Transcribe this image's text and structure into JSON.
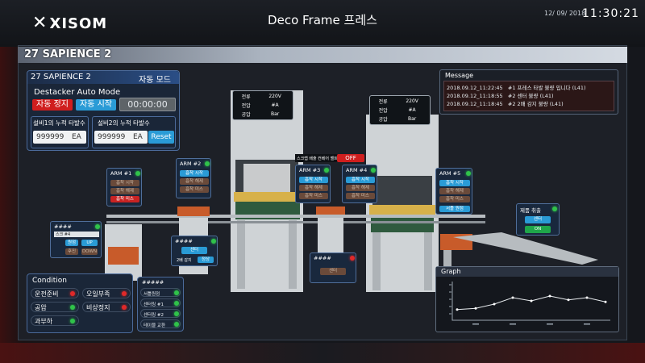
{
  "header": {
    "logo_text": "XISOM",
    "title": "Deco Frame 프레스",
    "date": "12/ 09/ 2018",
    "time": "11:30:21"
  },
  "frame": {
    "title": "27 SAPIENCE 2"
  },
  "main_panel": {
    "title": "27 SAPIENCE 2",
    "mode": "자동 모드",
    "subtitle": "Destacker Auto Mode",
    "stop_btn": "자동 정지",
    "start_btn": "자동 시작",
    "timer": "00:00:00",
    "counter1_label": "설비1의 누적 타발수",
    "counter1_value": "999999",
    "counter1_unit": "EA",
    "counter2_label": "설비2의 누적 타발수",
    "counter2_value": "999999",
    "counter2_unit": "EA",
    "reset_btn": "Reset"
  },
  "message": {
    "title": "Message",
    "rows": [
      {
        "time": "2018.09.12_11:22:45",
        "text": "#1 프레스 타발 불량 입니다 (L41)"
      },
      {
        "time": "2018.09.12_11:18:55",
        "text": "#2 센터 불량 (L41)"
      },
      {
        "time": "2018.09.12_11:18:45",
        "text": "#2 2배 감지 불량 (L41)"
      }
    ]
  },
  "press1_table": [
    {
      "label": "전류",
      "value": "220V"
    },
    {
      "label": "전압",
      "value": "#A"
    },
    {
      "label": "공압",
      "value": "Bar"
    }
  ],
  "press2_table": [
    {
      "label": "전류",
      "value": "220V"
    },
    {
      "label": "전압",
      "value": "#A"
    },
    {
      "label": "공압",
      "value": "Bar"
    }
  ],
  "conveyor": {
    "label": "스크랩 배출 컨베어 벨트",
    "state": "OFF"
  },
  "arms": {
    "arm1": {
      "title": "ARM #1",
      "b1": "흡착 시작",
      "b2": "흡착 해제",
      "b3": "흡착 미스"
    },
    "arm2": {
      "title": "ARM #2",
      "b1": "흡착 시작",
      "b2": "흡착 해제",
      "b3": "흡착 미스"
    },
    "arm3": {
      "title": "ARM #3",
      "b1": "흡착 시작",
      "b2": "흡착 해제",
      "b3": "흡착 미스"
    },
    "arm4": {
      "title": "ARM #4",
      "b1": "흡착 시작",
      "b2": "흡착 해제",
      "b3": "흡착 미스"
    },
    "arm5": {
      "title": "ARM #5",
      "b1": "흡착 시작",
      "b2": "흡착 해제",
      "b3": "흡착 미스",
      "b4": "서틀 원점"
    }
  },
  "destacker": {
    "title": "####",
    "sub": "스크 #4",
    "b_origin": "원점",
    "b_up": "UP",
    "b_back": "후진",
    "b_down": "DOWN"
  },
  "center1": {
    "title": "####",
    "btn": "센터",
    "label": "2배 감지",
    "btn2": "정상"
  },
  "center2": {
    "title": "####",
    "btn": "센터"
  },
  "product": {
    "title": "제품 취출",
    "btn": "센터",
    "state": "ON"
  },
  "condition": {
    "title": "Condition",
    "items": [
      "운전준비",
      "오일부족",
      "공압",
      "비상정지",
      "과부하"
    ]
  },
  "status_list": {
    "title": "#####",
    "items": [
      "서틀원점",
      "센터링 #1",
      "센터링 #2",
      "테이블 교환"
    ]
  },
  "graph": {
    "title": "Graph",
    "points": [
      0.18,
      0.22,
      0.35,
      0.55,
      0.45,
      0.6,
      0.48,
      0.55,
      0.42
    ]
  }
}
